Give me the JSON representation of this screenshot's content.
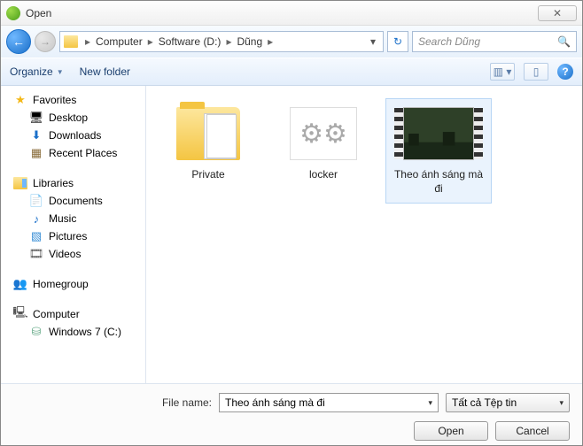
{
  "window": {
    "title": "Open",
    "close_glyph": "✕"
  },
  "nav": {
    "back_glyph": "←",
    "fwd_glyph": "→",
    "refresh_glyph": "↻",
    "crumbs": [
      "Computer",
      "Software (D:)",
      "Dũng"
    ],
    "chev": "▸",
    "dd": "▾"
  },
  "search": {
    "placeholder": "Search Dũng",
    "icon": "🔍"
  },
  "toolbar": {
    "organize": "Organize",
    "new_folder": "New folder",
    "dd": "▼",
    "view_glyph": "▥ ▾",
    "preview_glyph": "▯",
    "help_glyph": "?"
  },
  "sidebar": {
    "favorites": {
      "label": "Favorites",
      "icon": "★",
      "items": [
        {
          "label": "Desktop",
          "icon": "🖥"
        },
        {
          "label": "Downloads",
          "icon": "⬇"
        },
        {
          "label": "Recent Places",
          "icon": "▦"
        }
      ]
    },
    "libraries": {
      "label": "Libraries",
      "items": [
        {
          "label": "Documents",
          "icon": "📄"
        },
        {
          "label": "Music",
          "icon": "♪"
        },
        {
          "label": "Pictures",
          "icon": "▧"
        },
        {
          "label": "Videos",
          "icon": "🎞"
        }
      ]
    },
    "homegroup": {
      "label": "Homegroup",
      "icon": "👥"
    },
    "computer": {
      "label": "Computer",
      "icon": "🖳",
      "items": [
        {
          "label": "Windows 7 (C:)",
          "icon": "⛁"
        }
      ]
    }
  },
  "files": {
    "items": [
      {
        "name": "Private",
        "type": "folder"
      },
      {
        "name": "locker",
        "type": "gears"
      },
      {
        "name": "Theo ánh sáng mà đi",
        "type": "video",
        "selected": true
      }
    ]
  },
  "footer": {
    "filename_label": "File name:",
    "filename_value": "Theo ánh sáng mà đi",
    "filter_value": "Tất cả Tệp tin",
    "open_label": "Open",
    "cancel_label": "Cancel",
    "dd": "▾"
  }
}
